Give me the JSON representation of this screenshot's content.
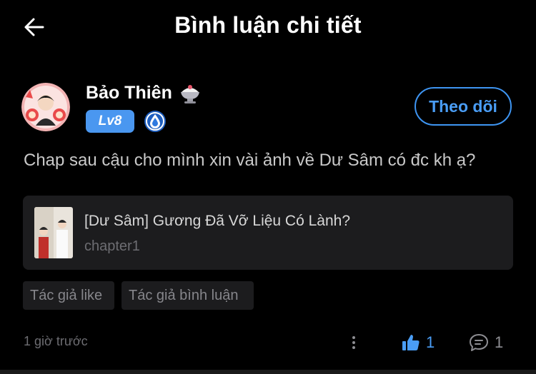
{
  "header": {
    "title": "Bình luận chi tiết",
    "back_icon": "back-arrow-icon"
  },
  "user": {
    "name": "Bảo Thiên",
    "decoration_icon": "shaved-ice-icon",
    "level": "Lv8",
    "rank_icon": "water-drop-badge-icon",
    "follow_label": "Theo dõi"
  },
  "comment": {
    "text": "Chap sau cậu cho mình xin vài ảnh về Dư Sâm có đc kh ạ?"
  },
  "chapter": {
    "title": "[Dư Sâm] Gương Đã Vỡ Liệu Có Lành?",
    "subtitle": "chapter1"
  },
  "tags": [
    "Tác giả like",
    "Tác giả bình luận"
  ],
  "footer": {
    "time": "1 giờ trước",
    "likes": "1",
    "comments": "1"
  },
  "colors": {
    "background": "#000000",
    "accent": "#4a9df5",
    "card": "#1c1c1e",
    "level_badge": "#4a97f0"
  }
}
